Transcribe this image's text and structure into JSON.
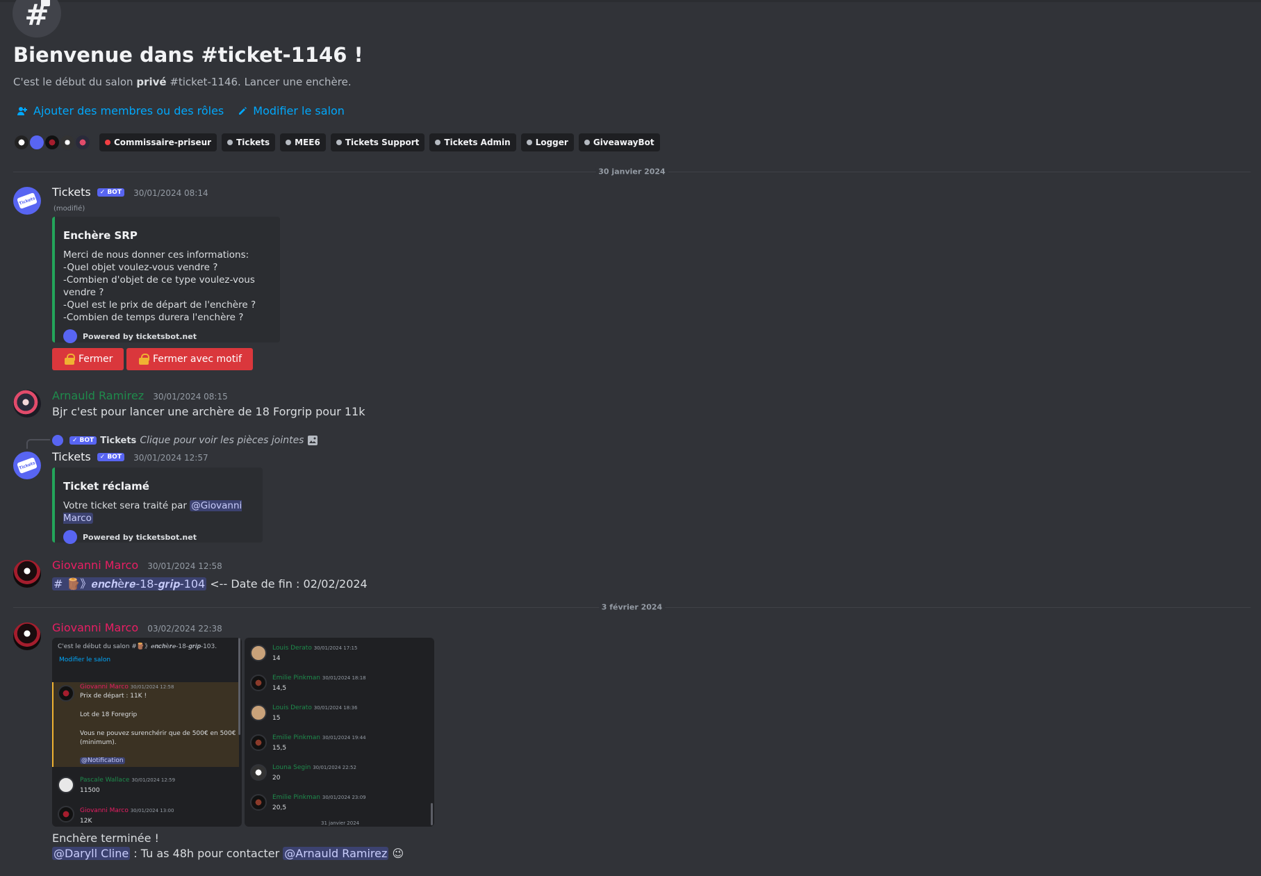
{
  "channel": {
    "welcome_title": "Bienvenue dans #ticket-1146 !",
    "sub_prefix": "C'est le début du salon ",
    "sub_bold": "privé",
    "sub_suffix": " #ticket-1146. Lancer une enchère.",
    "add_members": "Ajouter des membres ou des rôles",
    "edit_channel": "Modifier le salon"
  },
  "roles": [
    {
      "label": "Commissaire-priseur",
      "color": "#f23f43"
    },
    {
      "label": "Tickets",
      "color": "#b5bac1"
    },
    {
      "label": "MEE6",
      "color": "#b5bac1"
    },
    {
      "label": "Tickets Support",
      "color": "#b5bac1"
    },
    {
      "label": "Tickets Admin",
      "color": "#b5bac1"
    },
    {
      "label": "Logger",
      "color": "#b5bac1"
    },
    {
      "label": "GiveawayBot",
      "color": "#b5bac1"
    }
  ],
  "dividers": {
    "first": "30 janvier 2024",
    "second": "3 février 2024"
  },
  "messages": {
    "m1": {
      "author": "Tickets",
      "badge": "BOT",
      "timestamp": "30/01/2024 08:14",
      "edited": "(modifié)",
      "embed_title": "Enchère SRP",
      "embed_desc": "Merci de nous donner ces informations:\n-Quel objet voulez-vous vendre ?\n-Combien d'objet de ce type voulez-vous vendre ?\n-Quel est le prix de départ de l'enchère ?\n-Combien de temps durera l'enchère ?",
      "embed_footer": "Powered by ticketsbot.net",
      "btn_close": "Fermer",
      "btn_close_reason": "Fermer avec motif"
    },
    "m2": {
      "author": "Arnauld Ramirez",
      "author_color": "#1f8b4c",
      "timestamp": "30/01/2024 08:15",
      "text": "Bjr c'est pour lancer une archère de 18 Forgrip pour 11k"
    },
    "m3": {
      "reply_author": "Tickets",
      "reply_badge": "BOT",
      "reply_text": "Clique pour voir les pièces jointes",
      "author": "Tickets",
      "badge": "BOT",
      "timestamp": "30/01/2024 12:57",
      "embed_title": "Ticket réclamé",
      "embed_desc_prefix": "Votre ticket sera traité par ",
      "embed_mention": "@Giovanni Marco",
      "embed_footer": "Powered by ticketsbot.net"
    },
    "m4": {
      "author": "Giovanni Marco",
      "author_color": "#e91e63",
      "timestamp": "30/01/2024 12:58",
      "channel_mention": "# 🪵》𝒆𝒏𝒄𝒉è𝒓𝒆-18-𝒈𝒓𝒊𝒑-104",
      "text": " <-- Date de fin : 02/02/2024"
    },
    "m5": {
      "author": "Giovanni Marco",
      "author_color": "#e91e63",
      "timestamp": "03/02/2024 22:38",
      "text_line1": "Enchère terminée !",
      "mention1": "@Daryll Cline",
      "text_mid": " : Tu as 48h pour contacter ",
      "mention2": "@Arnauld Ramirez",
      "emoji": "😉"
    }
  },
  "attachment_left": {
    "header": "C'est le début du salon #🪵》𝒆𝒏𝒄𝒉è𝒓𝒆-18-𝒈𝒓𝒊𝒑-103.",
    "edit_link": "Modifier le salon",
    "msgs": [
      {
        "author": "Giovanni Marco",
        "ts": "30/01/2024 12:58",
        "lines": [
          "Prix de départ : 11K !",
          "",
          "Lot de 18 Foregrip",
          "",
          "Vous ne pouvez surenchérir que de 500€ en 500€",
          "(minimum).",
          "",
          "@Notification"
        ]
      },
      {
        "author": "Pascale Wallace",
        "ts": "30/01/2024 12:59",
        "lines": [
          "11500"
        ]
      },
      {
        "author": "Giovanni Marco",
        "ts": "30/01/2024 13:00",
        "lines": [
          "12K"
        ]
      }
    ]
  },
  "attachment_right": {
    "msgs": [
      {
        "author": "Louis Derato",
        "ts": "30/01/2024 17:15",
        "value": "14"
      },
      {
        "author": "Emilie Pinkman",
        "ts": "30/01/2024 18:18",
        "value": "14,5"
      },
      {
        "author": "Louis Derato",
        "ts": "30/01/2024 18:36",
        "value": "15"
      },
      {
        "author": "Emilie Pinkman",
        "ts": "30/01/2024 19:44",
        "value": "15,5"
      },
      {
        "author": "Louna Segin",
        "ts": "30/01/2024 22:52",
        "value": "20"
      },
      {
        "author": "Emilie Pinkman",
        "ts": "30/01/2024 23:09",
        "value": "20,5"
      }
    ],
    "divider": "31 janvier 2024"
  }
}
